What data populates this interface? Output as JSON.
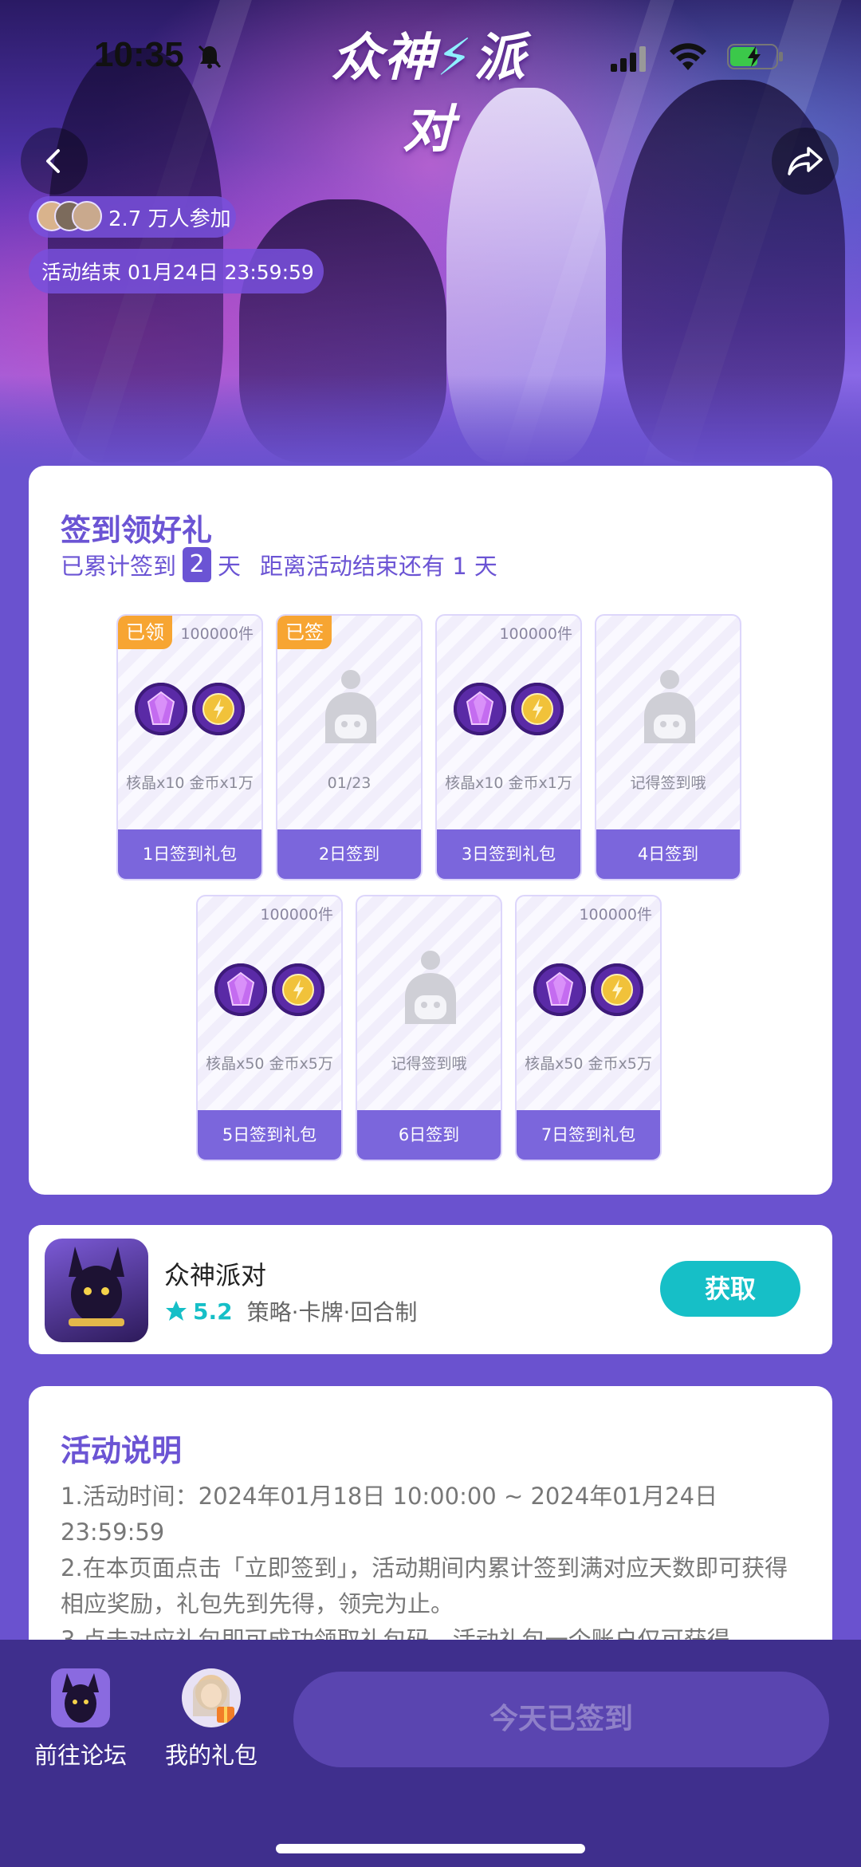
{
  "status_bar": {
    "time": "10:35"
  },
  "header": {
    "logo_text": "众神",
    "logo_text_2": "派对",
    "logo_bolt": "⚡"
  },
  "event": {
    "participants": "2.7 万人参加",
    "end_time": "活动结束 01月24日 23:59:59"
  },
  "checkin": {
    "title": "签到领好礼",
    "progress_prefix": "已累计签到",
    "days": "2",
    "days_unit": "天",
    "remaining": "距离活动结束还有 1 天",
    "tiles": [
      {
        "stock": "100000件",
        "badge": "已领",
        "kind": "reward",
        "desc": "核晶x10 金币x1万",
        "footer": "1日签到礼包"
      },
      {
        "stock": "",
        "badge": "已签",
        "kind": "placeholder",
        "desc": "01/23",
        "footer": "2日签到"
      },
      {
        "stock": "100000件",
        "badge": "",
        "kind": "reward",
        "desc": "核晶x10 金币x1万",
        "footer": "3日签到礼包"
      },
      {
        "stock": "",
        "badge": "",
        "kind": "placeholder",
        "desc": "记得签到哦",
        "footer": "4日签到"
      },
      {
        "stock": "100000件",
        "badge": "",
        "kind": "reward",
        "desc": "核晶x50 金币x5万",
        "footer": "5日签到礼包"
      },
      {
        "stock": "",
        "badge": "",
        "kind": "placeholder",
        "desc": "记得签到哦",
        "footer": "6日签到"
      },
      {
        "stock": "100000件",
        "badge": "",
        "kind": "reward",
        "desc": "核晶x50 金币x5万",
        "footer": "7日签到礼包"
      }
    ]
  },
  "app": {
    "name": "众神派对",
    "rating": "5.2",
    "tags": "策略·卡牌·回合制",
    "get_label": "获取"
  },
  "description": {
    "title": "活动说明",
    "lines": [
      "1.活动时间：2024年01月18日 10:00:00 ~ 2024年01月24日 23:59:59",
      "2.在本页面点击「立即签到」，活动期间内累计签到满对应天数即可获得相应奖励，礼包先到先得，领完为止。",
      "3.点击对应礼包即可成功领取礼包码，活动礼包一个账户仅可获得"
    ]
  },
  "bottom": {
    "forum_label": "前往论坛",
    "gifts_label": "我的礼包",
    "signed_label": "今天已签到"
  },
  "colors": {
    "accent": "#6b54d4",
    "teal": "#16bfc7",
    "badge": "#f7a532",
    "bottom_bar": "#3f2f8d"
  }
}
